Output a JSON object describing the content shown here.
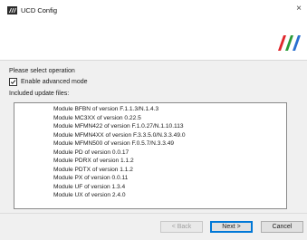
{
  "window": {
    "title": "UCD Config",
    "close_glyph": "×",
    "icons": {
      "app": "app-logo-icon",
      "brand": "brand-logo-icon",
      "close": "close-icon",
      "check": "check-icon"
    },
    "brand_colors": [
      "#e0262b",
      "#2b9b3a",
      "#2a6fd0"
    ]
  },
  "main": {
    "prompt": "Please select operation",
    "advanced_mode": {
      "label": "Enable advanced mode",
      "checked": true
    },
    "files_label": "Included update files:",
    "files": [
      "Module BFBN of version F.1.1.3/N.1.4.3",
      "Module MC3XX of version 0.22.5",
      "Module MFMN422 of version F.1.0.27/N.1.10.113",
      "Module MFMN4XX of version F.3.3.5.0/N.3.3.49.0",
      "Module MFMN500 of version F.0.5.7/N.3.3.49",
      "Module PD of version 0.0.17",
      "Module PDRX of version 1.1.2",
      "Module PDTX of version 1.1.2",
      "Module PX of version 0.0.11",
      "Module UF of version 1.3.4",
      "Module UX of version 2.4.0"
    ]
  },
  "footer": {
    "back_label": "< Back",
    "next_label": "Next >",
    "cancel_label": "Cancel"
  }
}
